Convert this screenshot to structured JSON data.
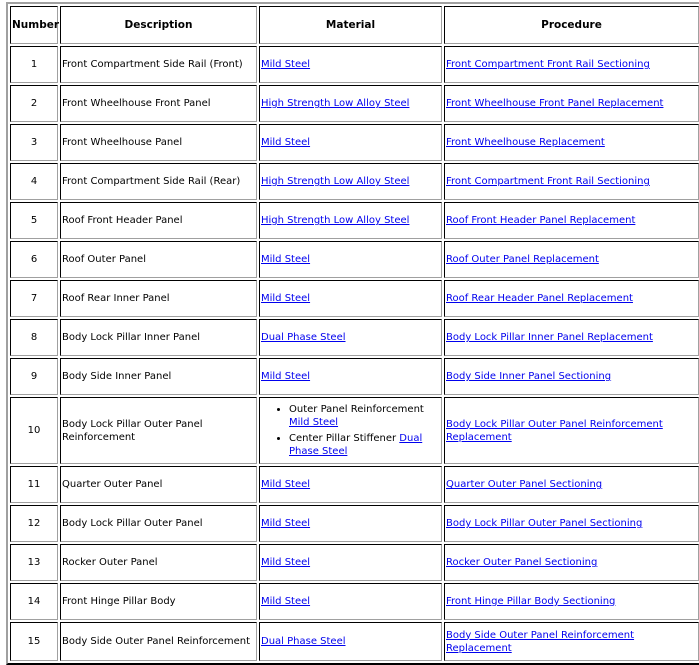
{
  "table": {
    "headers": {
      "number": "Number",
      "description": "Description",
      "material": "Material",
      "procedure": "Procedure"
    },
    "rows": [
      {
        "number": "1",
        "description": "Front Compartment Side Rail (Front)",
        "material": "Mild Steel",
        "procedure": "Front Compartment Front Rail Sectioning"
      },
      {
        "number": "2",
        "description": "Front Wheelhouse Front Panel",
        "material": "High Strength Low Alloy Steel",
        "procedure": "Front Wheelhouse Front Panel Replacement"
      },
      {
        "number": "3",
        "description": "Front Wheelhouse Panel",
        "material": "Mild Steel",
        "procedure": "Front Wheelhouse Replacement"
      },
      {
        "number": "4",
        "description": "Front Compartment Side Rail (Rear)",
        "material": "High Strength Low Alloy Steel",
        "procedure": "Front Compartment Front Rail Sectioning"
      },
      {
        "number": "5",
        "description": "Roof Front Header Panel",
        "material": "High Strength Low Alloy Steel",
        "procedure": "Roof Front Header Panel Replacement"
      },
      {
        "number": "6",
        "description": "Roof Outer Panel",
        "material": "Mild Steel",
        "procedure": "Roof Outer Panel Replacement"
      },
      {
        "number": "7",
        "description": "Roof Rear Inner Panel",
        "material": "Mild Steel",
        "procedure": "Roof Rear Header Panel Replacement"
      },
      {
        "number": "8",
        "description": "Body Lock Pillar Inner Panel",
        "material": "Dual Phase Steel",
        "procedure": "Body Lock Pillar Inner Panel Replacement"
      },
      {
        "number": "9",
        "description": "Body Side Inner Panel",
        "material": "Mild Steel",
        "procedure": "Body Side Inner Panel Sectioning"
      },
      {
        "number": "10",
        "description": "Body Lock Pillar Outer Panel Reinforcement",
        "material_list": [
          {
            "part": "Outer Panel Reinforcement",
            "material": "Mild Steel"
          },
          {
            "part": "Center Pillar Stiffener",
            "material": "Dual Phase Steel"
          }
        ],
        "procedure": "Body Lock Pillar Outer Panel Reinforcement Replacement"
      },
      {
        "number": "11",
        "description": "Quarter Outer Panel",
        "material": "Mild Steel",
        "procedure": "Quarter Outer Panel Sectioning"
      },
      {
        "number": "12",
        "description": "Body Lock Pillar Outer Panel",
        "material": "Mild Steel",
        "procedure": "Body Lock Pillar Outer Panel Sectioning"
      },
      {
        "number": "13",
        "description": "Rocker Outer Panel",
        "material": "Mild Steel",
        "procedure": "Rocker Outer Panel Sectioning"
      },
      {
        "number": "14",
        "description": "Front Hinge Pillar Body",
        "material": "Mild Steel",
        "procedure": "Front Hinge Pillar Body Sectioning"
      },
      {
        "number": "15",
        "description": "Body Side Outer Panel Reinforcement",
        "material": "Dual Phase Steel",
        "procedure": "Body Side Outer Panel Reinforcement Replacement"
      }
    ]
  },
  "colors": {
    "link": "#0000ee",
    "border_dark": "#000000",
    "border_light": "#a0a0a0"
  }
}
